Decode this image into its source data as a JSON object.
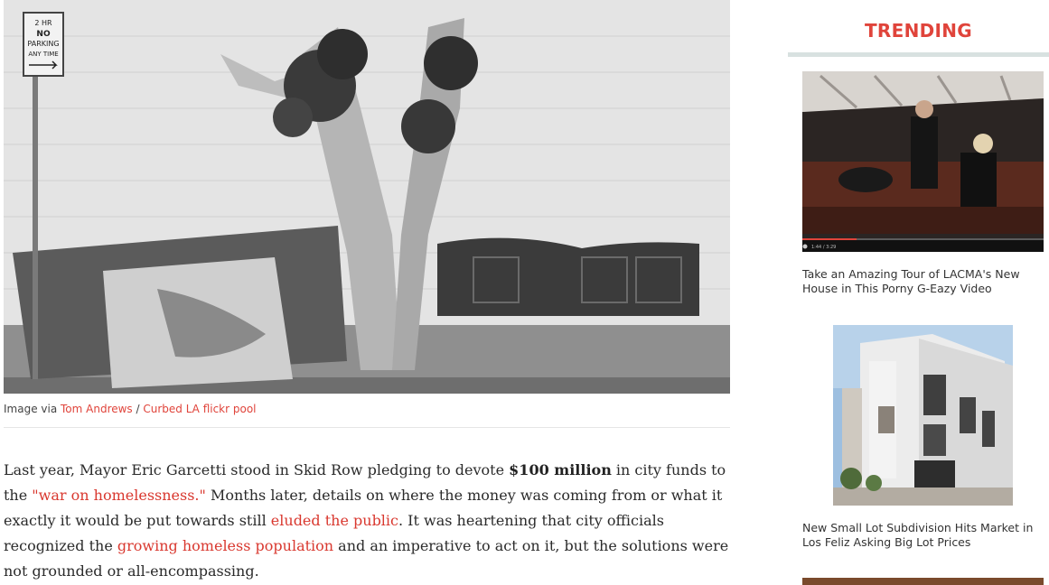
{
  "hero": {
    "sign_text": [
      "2 HR",
      "NO",
      "PARKING",
      "ANY TIME"
    ],
    "caption_prefix": "Image via ",
    "caption_author": "Tom Andrews",
    "caption_sep": " / ",
    "caption_source": "Curbed LA flickr pool"
  },
  "article": {
    "p1_a": "Last year, Mayor Eric Garcetti stood in Skid Row pledging to devote ",
    "p1_bold": "$100 million",
    "p1_b": " in city funds to the ",
    "p1_link1": "\"war on homelessness.\"",
    "p1_c": " Months later, details on where the money was coming from or what it exactly it would be put towards still ",
    "p1_link2": "eluded the public",
    "p1_d": ". It was heartening that city officials recognized the ",
    "p1_link3": "growing homeless population",
    "p1_e": " and an imperative to act on it, but the solutions were not grounded or all-encompassing."
  },
  "sidebar": {
    "title": "TRENDING",
    "items": [
      {
        "title": "Take an Amazing Tour of LACMA's New House in This Porny G-Eazy Video",
        "video_time": "1:44 / 3:29"
      },
      {
        "title": "New Small Lot Subdivision Hits Market in Los Feliz Asking Big Lot Prices"
      }
    ]
  },
  "colors": {
    "accent": "#e0443b",
    "link": "#d9382f",
    "rule": "#d8e1e0"
  }
}
